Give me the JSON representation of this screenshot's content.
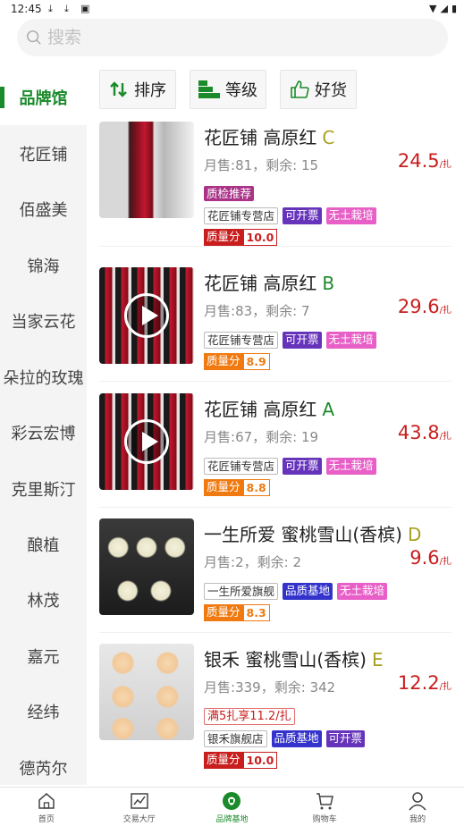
{
  "status": {
    "time": "12:45"
  },
  "search": {
    "placeholder": "搜索"
  },
  "sidebar": {
    "items": [
      "品牌馆",
      "花匠铺",
      "佰盛美",
      "锦海",
      "当家云花",
      "朵拉的玫瑰",
      "彩云宏博",
      "克里斯汀",
      "酿植",
      "林茂",
      "嘉元",
      "经纬",
      "德芮尔"
    ]
  },
  "filters": {
    "sort": "排序",
    "grade": "等级",
    "good": "好货"
  },
  "products": [
    {
      "name": "花匠铺 高原红",
      "grade": "C",
      "sales_label": "月售:",
      "sales": "81",
      "stock_label": "剩余:",
      "stock": "15",
      "price": "24.5",
      "unit": "/扎",
      "qc": "质检推荐",
      "shop": "花匠铺专营店",
      "tag2": "可开票",
      "tag3": "无土栽培",
      "score_label": "质量分",
      "score": "10.0"
    },
    {
      "name": "花匠铺 高原红",
      "grade": "B",
      "sales_label": "月售:",
      "sales": "83",
      "stock_label": "剩余:",
      "stock": "7",
      "price": "29.6",
      "unit": "/扎",
      "shop": "花匠铺专营店",
      "tag2": "可开票",
      "tag3": "无土栽培",
      "score_label": "质量分",
      "score": "8.9"
    },
    {
      "name": "花匠铺 高原红",
      "grade": "A",
      "sales_label": "月售:",
      "sales": "67",
      "stock_label": "剩余:",
      "stock": "19",
      "price": "43.8",
      "unit": "/扎",
      "shop": "花匠铺专营店",
      "tag2": "可开票",
      "tag3": "无土栽培",
      "score_label": "质量分",
      "score": "8.8"
    },
    {
      "name": "一生所爱 蜜桃雪山(香槟)",
      "grade": "D",
      "sales_label": "月售:",
      "sales": "2",
      "stock_label": "剩余:",
      "stock": "2",
      "price": "9.6",
      "unit": "/扎",
      "shop": "一生所爱旗舰",
      "tag2": "品质基地",
      "tag3": "无土栽培",
      "score_label": "质量分",
      "score": "8.3"
    },
    {
      "name": "银禾 蜜桃雪山(香槟)",
      "grade": "E",
      "sales_label": "月售:",
      "sales": "339",
      "stock_label": "剩余:",
      "stock": "342",
      "price": "12.2",
      "unit": "/扎",
      "promo": "满5扎享11.2/扎",
      "shop": "银禾旗舰店",
      "tag2": "品质基地",
      "tag3": "可开票",
      "score_label": "质量分",
      "score": "10.0"
    }
  ],
  "nav": {
    "home": "首页",
    "trade": "交易大厅",
    "brand": "品牌基地",
    "cart": "购物车",
    "mine": "我的"
  },
  "colors": {
    "accent": "#1a8a2a",
    "price": "#c81e1e",
    "grade": "#a8a020"
  }
}
